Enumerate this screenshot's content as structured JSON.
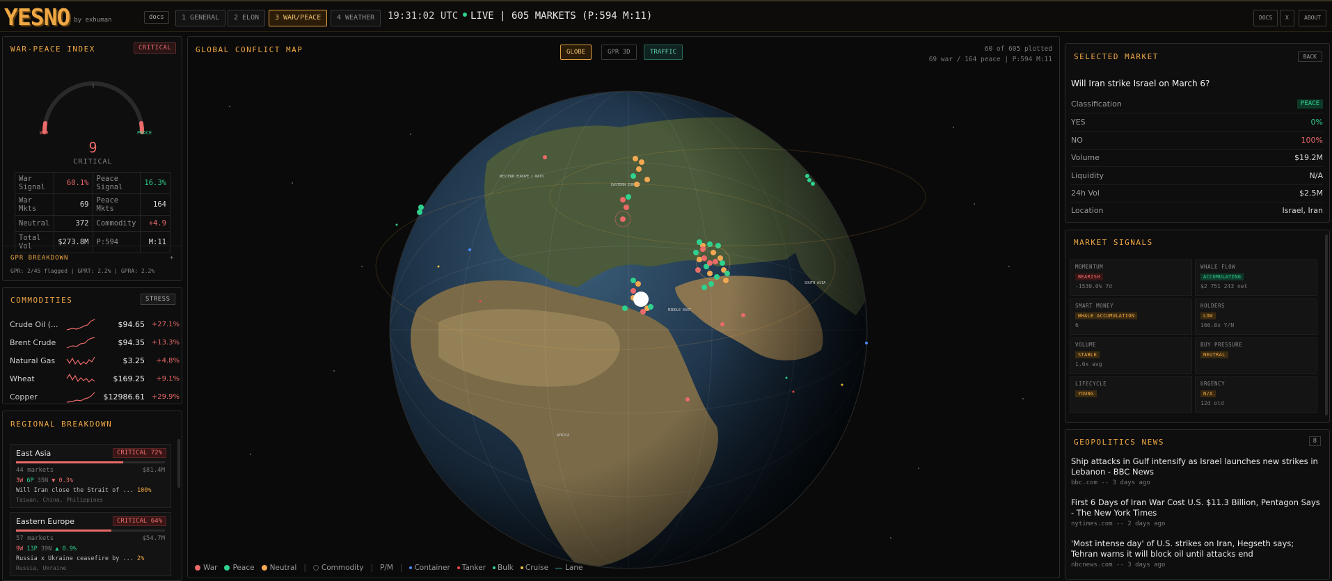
{
  "header": {
    "logo": "YESNO",
    "by": "by exhuman",
    "docs": "docs",
    "tabs": [
      "1 GENERAL",
      "2 ELON",
      "3 WAR/PEACE",
      "4 WEATHER"
    ],
    "active_tab": "3 WAR/PEACE",
    "clock": "19:31:02 UTC",
    "live": "LIVE | 605 MARKETS (P:594 M:11)",
    "right_buttons": [
      "DOCS",
      "X",
      "ABOUT"
    ]
  },
  "index": {
    "title": "WAR-PEACE INDEX",
    "badge": "CRITICAL",
    "gauge_left": "WAR",
    "gauge_right": "PEACE",
    "value": "9",
    "status": "CRITICAL",
    "stats": [
      [
        "War Signal",
        "60.1%",
        "Peace Signal",
        "16.3%"
      ],
      [
        "War Mkts",
        "69",
        "Peace Mkts",
        "164"
      ],
      [
        "Neutral",
        "372",
        "Commodity",
        "+4.9"
      ],
      [
        "Total Vol",
        "$273.8M",
        "P:594",
        "M:11"
      ]
    ],
    "gpr_title": "GPR BREAKDOWN",
    "gpr_toggle": "+",
    "gpr_line": "GPR: 2/45 flagged | GPRT: 2.2% | GPRA: 2.2%"
  },
  "commodities": {
    "title": "COMMODITIES",
    "badge": "STRESS",
    "items": [
      {
        "name": "Crude Oil (...",
        "price": "$94.65",
        "change": "+27.1%"
      },
      {
        "name": "Brent Crude",
        "price": "$94.35",
        "change": "+13.3%"
      },
      {
        "name": "Natural Gas",
        "price": "$3.25",
        "change": "+4.8%"
      },
      {
        "name": "Wheat",
        "price": "$169.25",
        "change": "+9.1%"
      },
      {
        "name": "Copper",
        "price": "$12986.61",
        "change": "+29.9%"
      }
    ]
  },
  "regional": {
    "title": "REGIONAL BREAKDOWN",
    "items": [
      {
        "name": "East Asia",
        "badge": "CRITICAL 72%",
        "level": 0.72,
        "markets": "44 markets",
        "volume": "$81.4M",
        "w": "3W",
        "p": "6P",
        "n": "35N",
        "trend": "▼ 0.3%",
        "question": "Will Iran close the Strait of ...",
        "pct": "100%",
        "locations": "Taiwan, China, Philippines"
      },
      {
        "name": "Eastern Europe",
        "badge": "CRITICAL 64%",
        "level": 0.64,
        "markets": "57 markets",
        "volume": "$54.7M",
        "w": "9W",
        "p": "13P",
        "n": "39N",
        "trend": "▲ 0.9%",
        "question": "Russia x Ukraine ceasefire by ...",
        "pct": "2%",
        "locations": "Russia, Ukraine"
      }
    ]
  },
  "map": {
    "title": "GLOBAL CONFLICT MAP",
    "buttons": [
      "GLOBE",
      "GPR 3D",
      "TRAFFIC"
    ],
    "plotted": "60 of 605 plotted",
    "counts": "69 war / 164 peace | P:594 M:11",
    "labels": {
      "western_europe": "WESTERN EUROPE / NATO",
      "eastern_europe": "EASTERN EUROPE",
      "middle_east": "MIDDLE EAST",
      "south_asia": "SOUTH ASIA",
      "africa": "AFRICA"
    },
    "legend": [
      "War",
      "Peace",
      "Neutral",
      "Commodity",
      "P/M",
      "Container",
      "Tanker",
      "Bulk",
      "Cruise",
      "Lane"
    ],
    "legend_sep": "|",
    "colors": {
      "war": "#ec6a6a",
      "peace": "#2fd18e",
      "neutral": "#f3a852",
      "container": "#4a8cff",
      "tanker": "#ec4a4a",
      "bulk": "#2fd18e",
      "cruise": "#f0c040"
    }
  },
  "selected": {
    "title": "SELECTED MARKET",
    "back": "BACK",
    "question": "Will Iran strike Israel on March 6?",
    "rows": [
      {
        "label": "Classification",
        "value": "PEACE"
      },
      {
        "label": "YES",
        "value": "0%"
      },
      {
        "label": "NO",
        "value": "100%"
      },
      {
        "label": "Volume",
        "value": "$19.2M"
      },
      {
        "label": "Liquidity",
        "value": "N/A"
      },
      {
        "label": "24h Vol",
        "value": "$2.5M"
      },
      {
        "label": "Location",
        "value": "Israel, Iran"
      }
    ]
  },
  "signals": {
    "title": "MARKET SIGNALS",
    "items": [
      {
        "title": "MOMENTUM",
        "badge": "BEARISH",
        "sub": "-1530.0% 7d"
      },
      {
        "title": "WHALE FLOW",
        "badge": "ACCUMULATING",
        "sub": "$2 751 243 net"
      },
      {
        "title": "SMART MONEY",
        "badge": "WHALE ACCUMULATION",
        "sub": "6"
      },
      {
        "title": "HOLDERS",
        "badge": "LOW",
        "sub": "166.0x Y/N"
      },
      {
        "title": "VOLUME",
        "badge": "STABLE",
        "sub": "1.0x avg"
      },
      {
        "title": "BUY PRESSURE",
        "badge": "NEUTRAL",
        "sub": ""
      },
      {
        "title": "LIFECYCLE",
        "badge": "YOUNG",
        "sub": ""
      },
      {
        "title": "URGENCY",
        "badge": "N/A",
        "sub": "12d old"
      }
    ]
  },
  "news": {
    "title": "GEOPOLITICS NEWS",
    "count": "8",
    "items": [
      {
        "headline": "Ship attacks in Gulf intensify as Israel launches new strikes in Lebanon - BBC News",
        "source": "bbc.com -- 3 days ago"
      },
      {
        "headline": "First 6 Days of Iran War Cost U.S. $11.3 Billion, Pentagon Says - The New York Times",
        "source": "nytimes.com -- 2 days ago"
      },
      {
        "headline": "'Most intense day' of U.S. strikes on Iran, Hegseth says; Tehran warns it will block oil until attacks end",
        "source": "nbcnews.com -- 3 days ago"
      }
    ]
  }
}
